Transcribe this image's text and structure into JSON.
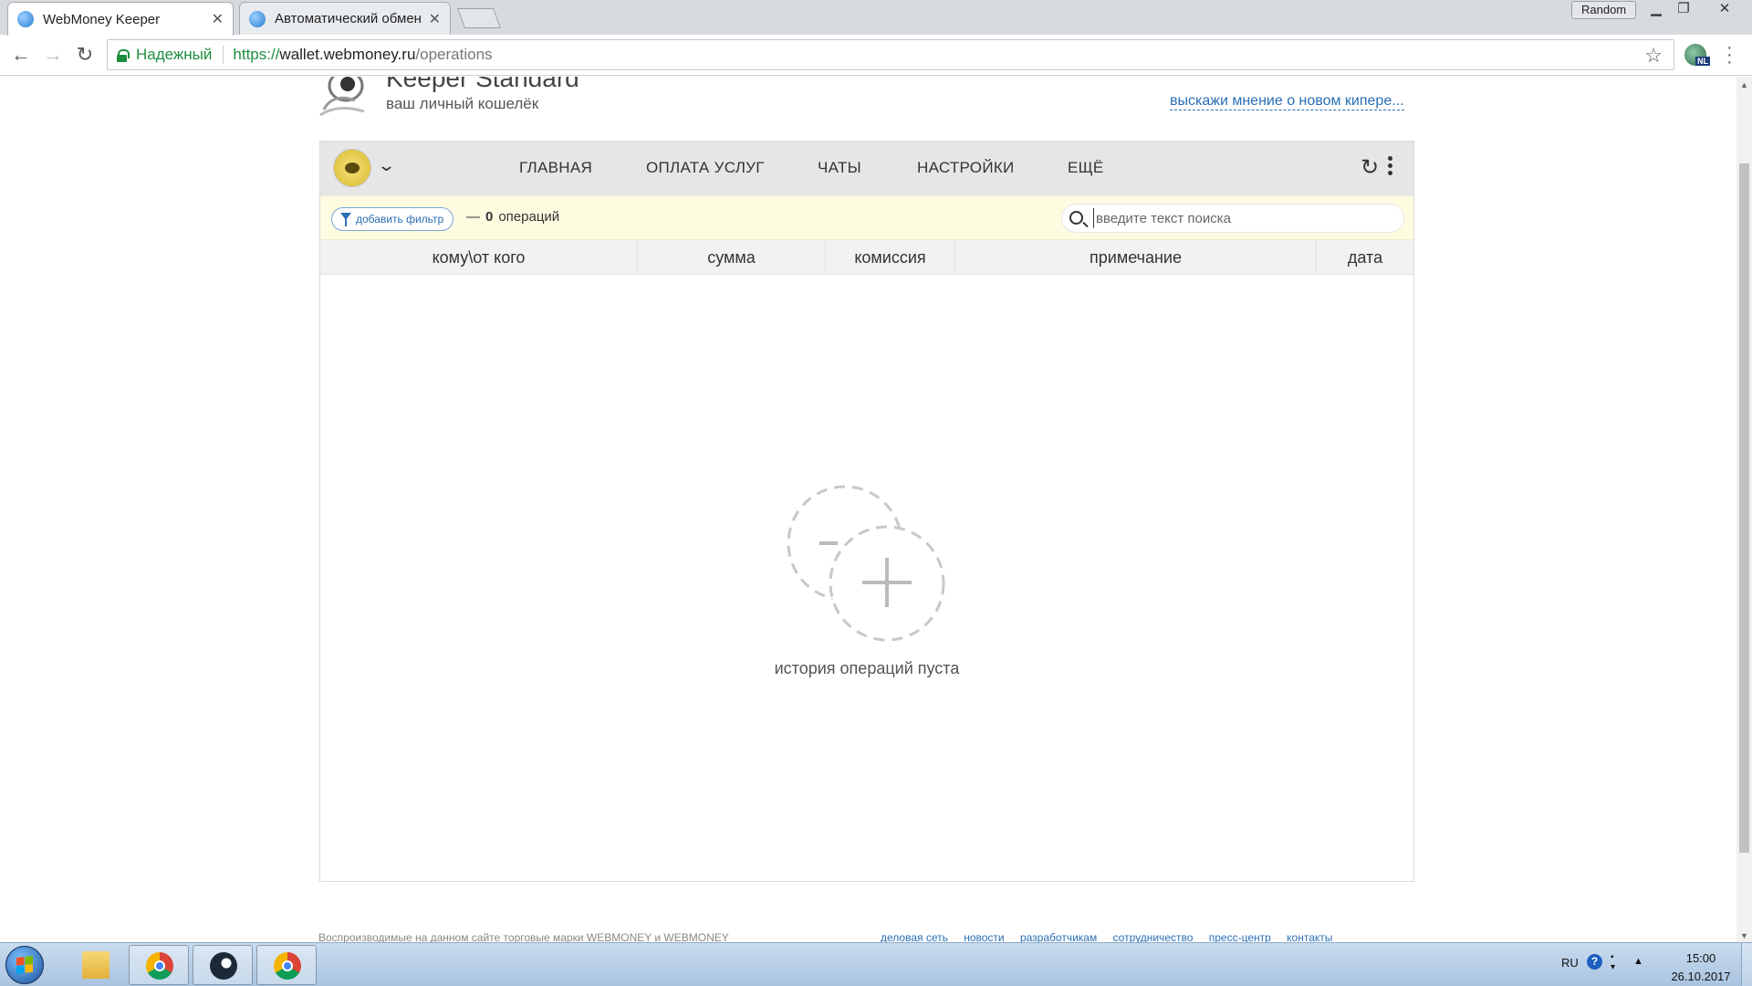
{
  "browser": {
    "tabs": [
      {
        "title": "WebMoney Keeper",
        "active": true
      },
      {
        "title": "Автоматический обмен",
        "active": false
      }
    ],
    "profile": "Random",
    "secure_label": "Надежный",
    "url": {
      "scheme": "https://",
      "host": "wallet.webmoney.ru",
      "path": "/operations"
    },
    "extension_badge": "NL"
  },
  "page": {
    "brand_title": "Keeper Standard",
    "brand_subtitle": "ваш личный кошелёк",
    "feedback_link": "выскажи мнение о новом кипере..."
  },
  "app": {
    "nav": [
      "ГЛАВНАЯ",
      "ОПЛАТА УСЛУГ",
      "ЧАТЫ",
      "НАСТРОЙКИ",
      "ЕЩЁ"
    ],
    "filter_button": "добавить фильтр",
    "ops_dash": "—",
    "ops_count": "0",
    "ops_label": "операций",
    "search_placeholder": "введите текст поиска",
    "columns": [
      "кому\\от кого",
      "сумма",
      "комиссия",
      "примечание",
      "дата"
    ],
    "empty_message": "история операций пуста"
  },
  "footer": {
    "text": "Воспроизводимые на данном сайте торговые марки WEBMONEY и WEBMONEY",
    "links": [
      "деловая сеть",
      "новости",
      "разработчикам",
      "сотрудничество",
      "пресс-центр",
      "контакты"
    ]
  },
  "taskbar": {
    "lang": "RU",
    "time": "15:00",
    "date": "26.10.2017"
  },
  "colors": {
    "accent_link": "#2a6fb5",
    "secure_green": "#1e8e3e",
    "filter_bar_bg": "#fdfbe0",
    "app_header_bg": "#e6e6e6"
  }
}
